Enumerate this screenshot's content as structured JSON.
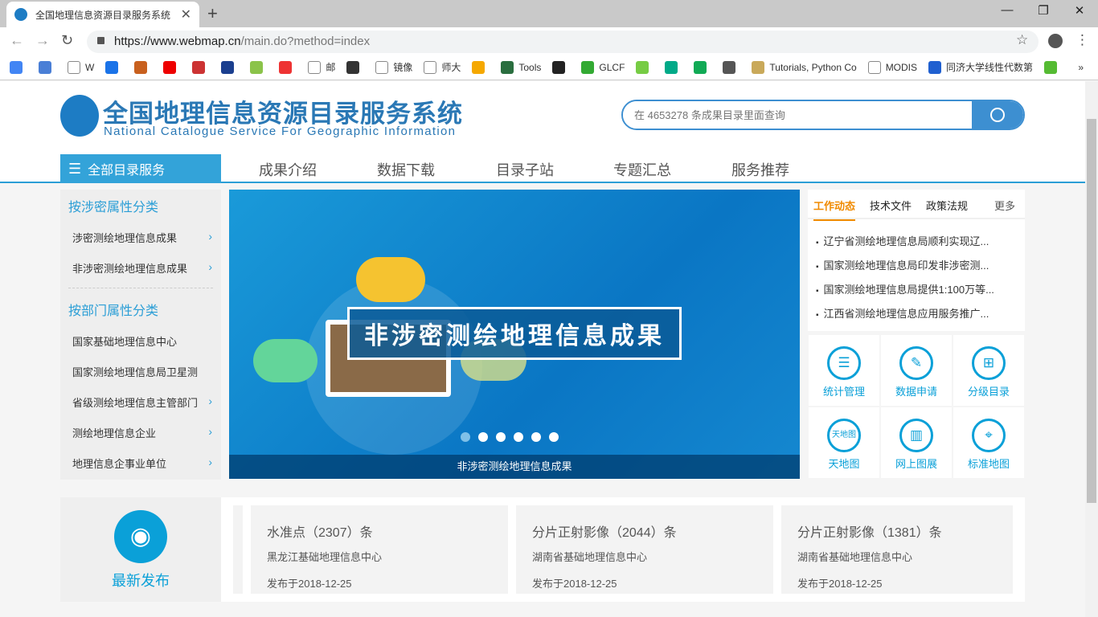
{
  "browser": {
    "tab_title": "全国地理信息资源目录服务系统",
    "url_host": "https://www.webmap.cn",
    "url_path": "/main.do?method=index",
    "bookmarks": [
      "",
      "",
      "W",
      "",
      "",
      "",
      "",
      "",
      "",
      "",
      "邮",
      "",
      "镜像",
      "师大",
      "",
      "Tools",
      "",
      "GLCF",
      "",
      "",
      "",
      "",
      "Tutorials, Python Co",
      "MODIS",
      "同济大学线性代数第",
      "",
      "»"
    ],
    "win_minimize": "—",
    "win_restore": "❐",
    "win_close": "✕",
    "new_tab": "+",
    "close_tab": "✕"
  },
  "header": {
    "logo_cn": "全国地理信息资源目录服务系统",
    "logo_en": "National Catalogue Service For Geographic Information",
    "search_placeholder": "在 4653278 条成果目录里面查询"
  },
  "nav": {
    "all": "全部目录服务",
    "items": [
      "成果介绍",
      "数据下载",
      "目录子站",
      "专题汇总",
      "服务推荐"
    ]
  },
  "sidebar": {
    "heading1": "按涉密属性分类",
    "group1": [
      "涉密测绘地理信息成果",
      "非涉密测绘地理信息成果"
    ],
    "heading2": "按部门属性分类",
    "group2": [
      "国家基础地理信息中心",
      "国家测绘地理信息局卫星测",
      "省级测绘地理信息主管部门",
      "测绘地理信息企业",
      "地理信息企事业单位"
    ]
  },
  "banner": {
    "title": "非涉密测绘地理信息成果",
    "caption": "非涉密测绘地理信息成果",
    "slide_count": 6,
    "active_slide": 1
  },
  "news": {
    "tabs": [
      "工作动态",
      "技术文件",
      "政策法规"
    ],
    "more": "更多",
    "active_tab": "工作动态",
    "items": [
      "辽宁省测绘地理信息局顺利实现辽...",
      "国家测绘地理信息局印发非涉密测...",
      "国家测绘地理信息局提供1:100万等...",
      "江西省测绘地理信息应用服务推广..."
    ]
  },
  "tiles": [
    {
      "label": "统计管理",
      "icon": "list-icon"
    },
    {
      "label": "数据申请",
      "icon": "edit-icon"
    },
    {
      "label": "分级目录",
      "icon": "hierarchy-icon"
    },
    {
      "label": "天地图",
      "icon": "tianditu-logo-icon"
    },
    {
      "label": "网上图展",
      "icon": "map-exhibit-icon"
    },
    {
      "label": "标准地图",
      "icon": "map-pin-icon"
    }
  ],
  "latest": {
    "label": "最新发布",
    "cards": [
      {
        "title": "水准点（2307）条",
        "org": "黑龙江基础地理信息中心",
        "date": "发布于2018-12-25"
      },
      {
        "title": "分片正射影像（2044）条",
        "org": "湖南省基础地理信息中心",
        "date": "发布于2018-12-25"
      },
      {
        "title": "分片正射影像（1381）条",
        "org": "湖南省基础地理信息中心",
        "date": "发布于2018-12-25"
      }
    ]
  },
  "colors": {
    "brand": "#2a78b5",
    "accent": "#0aa0d8",
    "active_tab": "#f08a00"
  }
}
